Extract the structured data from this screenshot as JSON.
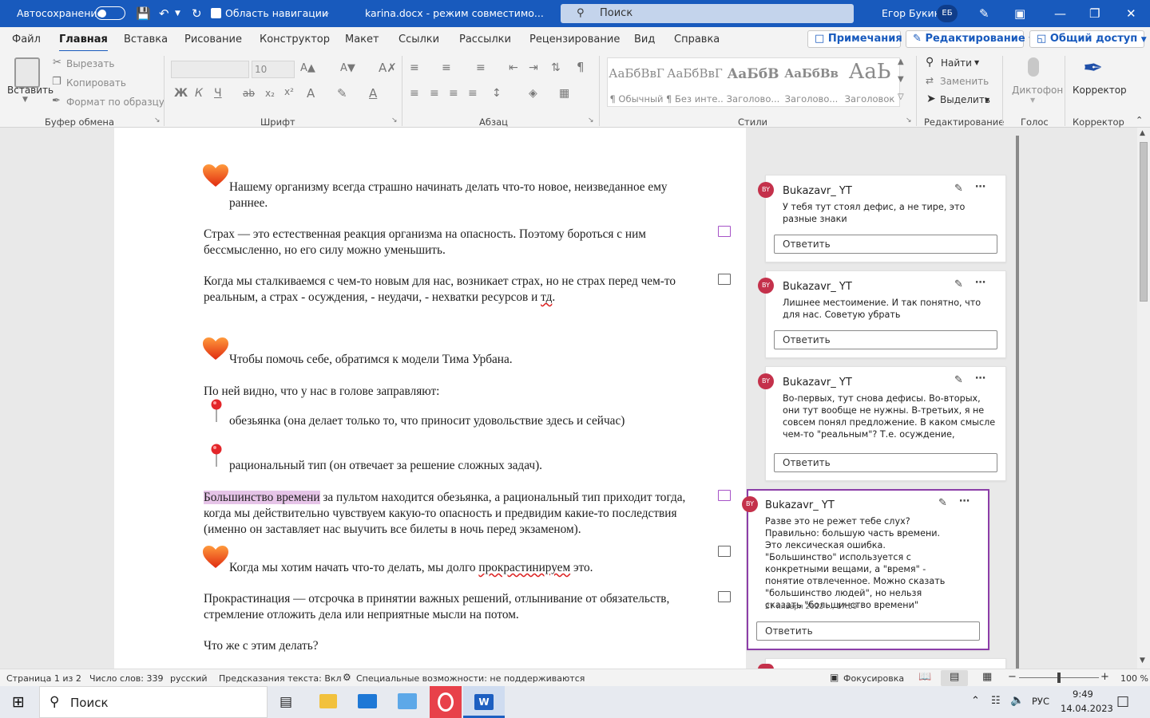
{
  "title_bar": {
    "autosave_label": "Автосохранение",
    "nav_pane_label": "Область навигации",
    "doc_title": "karina.docx  -  режим совместимо...",
    "search_placeholder": "Поиск",
    "user_name": "Егор Букин",
    "user_initials": "ЕБ"
  },
  "tabs": [
    "Файл",
    "Главная",
    "Вставка",
    "Рисование",
    "Конструктор",
    "Макет",
    "Ссылки",
    "Рассылки",
    "Рецензирование",
    "Вид",
    "Справка"
  ],
  "active_tab": "Главная",
  "right_buttons": {
    "comments": "Примечания",
    "editing": "Редактирование",
    "share": "Общий доступ"
  },
  "ribbon": {
    "clipboard": {
      "paste": "Вставить",
      "cut": "Вырезать",
      "copy": "Копировать",
      "format_painter": "Формат по образцу",
      "group": "Буфер обмена"
    },
    "font": {
      "size": "10",
      "bold": "Ж",
      "italic": "К",
      "underline": "Ч",
      "strike": "ab",
      "group": "Шрифт"
    },
    "paragraph": {
      "group": "Абзац"
    },
    "styles": {
      "items": [
        {
          "sample": "АаБбВвГ",
          "name": "¶ Обычный"
        },
        {
          "sample": "АаБбВвГ",
          "name": "¶ Без инте..."
        },
        {
          "sample": "АаБбВ",
          "name": "Заголово..."
        },
        {
          "sample": "АаБбВв",
          "name": "Заголово..."
        },
        {
          "sample": "АаЬ",
          "name": "Заголовок"
        }
      ],
      "group": "Стили"
    },
    "editing": {
      "find": "Найти",
      "replace": "Заменить",
      "select": "Выделить",
      "group": "Редактирование"
    },
    "voice": {
      "dictate": "Диктофон",
      "group": "Голос"
    },
    "corrector": {
      "label": "Корректор",
      "group": "Корректор"
    }
  },
  "document": {
    "p1": "Нашему организму всегда страшно начинать делать что-то новое, неизведанное ему раннее.",
    "p2": "Страх — это естественная реакция организма на опасность. Поэтому бороться с ним бессмысленно, но его силу можно уменьшить.",
    "p3_a": "Когда мы сталкиваемся с чем-то новым для нас, возникает страх, но не страх перед чем-то реальным, а страх - осуждения, - неудачи, - нехватки ресурсов и ",
    "p3_b": "тд",
    "p3_c": ".",
    "p4": "Чтобы помочь себе, обратимся к модели Тима Урбана.",
    "p5": "По ней видно, что у нас в голове заправляют:",
    "li1": "обезьянка (она делает только то, что приносит удовольствие здесь и сейчас)",
    "li2": "рациональный тип (он отвечает за решение сложных задач).",
    "p6_hl": "Большинство времени",
    "p6_rest": " за пультом находится обезьянка, а рациональный тип приходит тогда, когда мы действительно чувствуем какую-то опасность и предвидим какие-то последствия (именно он заставляет нас выучить все билеты в ночь перед экзаменом).",
    "p7_a": "Когда мы хотим начать что-то делать, мы долго ",
    "p7_b": "прокрастинируем",
    "p7_c": " это.",
    "p8": "Прокрастинация — отсрочка в принятии важных решений, отлынивание от обязательств, стремление отложить дела или неприятные мысли на потом.",
    "p9": "Что же с этим делать?"
  },
  "comments": [
    {
      "initials": "BY",
      "author": "Bukazavr_ YT",
      "text": "У тебя тут стоял дефис, а не тире, это разные знаки",
      "reply": "Ответить"
    },
    {
      "initials": "BY",
      "author": "Bukazavr_ YT",
      "text": "Лишнее местоимение. И так понятно, что для нас. Советую убрать",
      "reply": "Ответить"
    },
    {
      "initials": "BY",
      "author": "Bukazavr_ YT",
      "text": "Во-первых, тут снова дефисы. Во-вторых, они тут вообще не нужны. В-третьих, я не совсем понял предложение. В каком смысле чем-то \"реальным\"? Т.е. осуждение, неудача, нехватка",
      "reply": "Ответить"
    },
    {
      "initials": "BY",
      "author": "Bukazavr_ YT",
      "text": "Разве это не режет тебе слух? Правильно: большую часть времени. Это лексическая ошибка. \"Большинство\" используется с конкретными вещами, а \"время\" - понятие отвлеченное. Можно сказать \"большинство людей\", но нельзя сказать \"большинство времени\"",
      "date": "27 января 2023 г., 17:59",
      "reply": "Ответить"
    }
  ],
  "status_bar": {
    "page": "Страница 1 из 2",
    "words": "Число слов: 339",
    "language": "русский",
    "predictions": "Предсказания текста: Вкл",
    "accessibility": "Специальные возможности: не поддерживаются",
    "focus": "Фокусировка",
    "zoom": "100 %"
  },
  "taskbar": {
    "search": "Поиск",
    "lang": "РУС",
    "time": "9:49",
    "date": "14.04.2023"
  },
  "colors": {
    "accent": "#185abd",
    "comment_active": "#8c3ea8",
    "highlight": "#e6c4e8",
    "avatar": "#c4314b"
  }
}
